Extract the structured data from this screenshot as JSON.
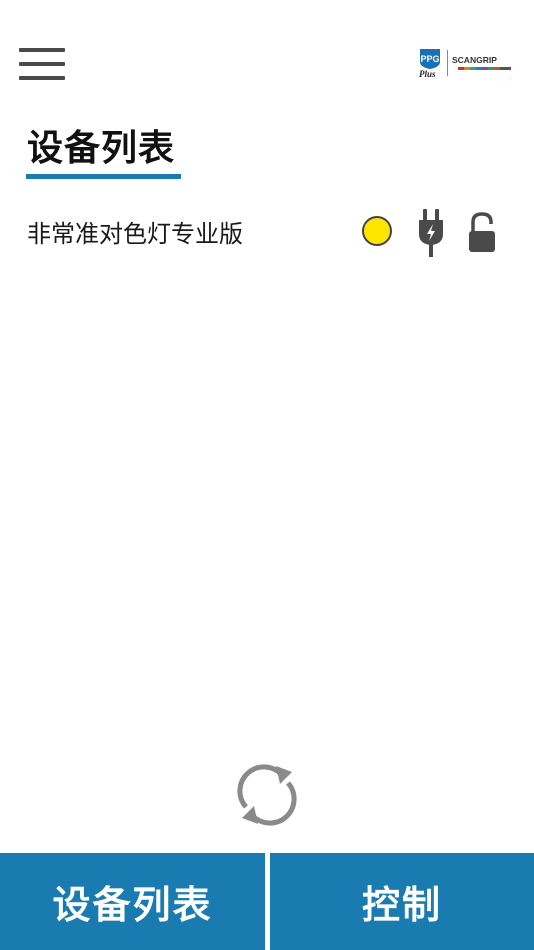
{
  "header": {
    "menu_icon": "hamburger-menu-icon",
    "logo": {
      "ppg_text": "PPG",
      "plus_text": "Plus",
      "scangrip_text": "SCANGRIP"
    }
  },
  "page": {
    "title": "设备列表"
  },
  "devices": [
    {
      "name": "非常准对色灯专业版",
      "status_color": "#ffe600",
      "status_icon": "status-dot-icon",
      "power_icon": "plug-icon",
      "lock_icon": "unlocked-lock-icon"
    }
  ],
  "refresh": {
    "icon": "refresh-icon"
  },
  "bottom_nav": {
    "device_list_label": "设备列表",
    "control_label": "控制"
  },
  "colors": {
    "accent": "#1a7bb0",
    "status_yellow": "#ffe600",
    "icon_gray": "#4a4a4a"
  }
}
